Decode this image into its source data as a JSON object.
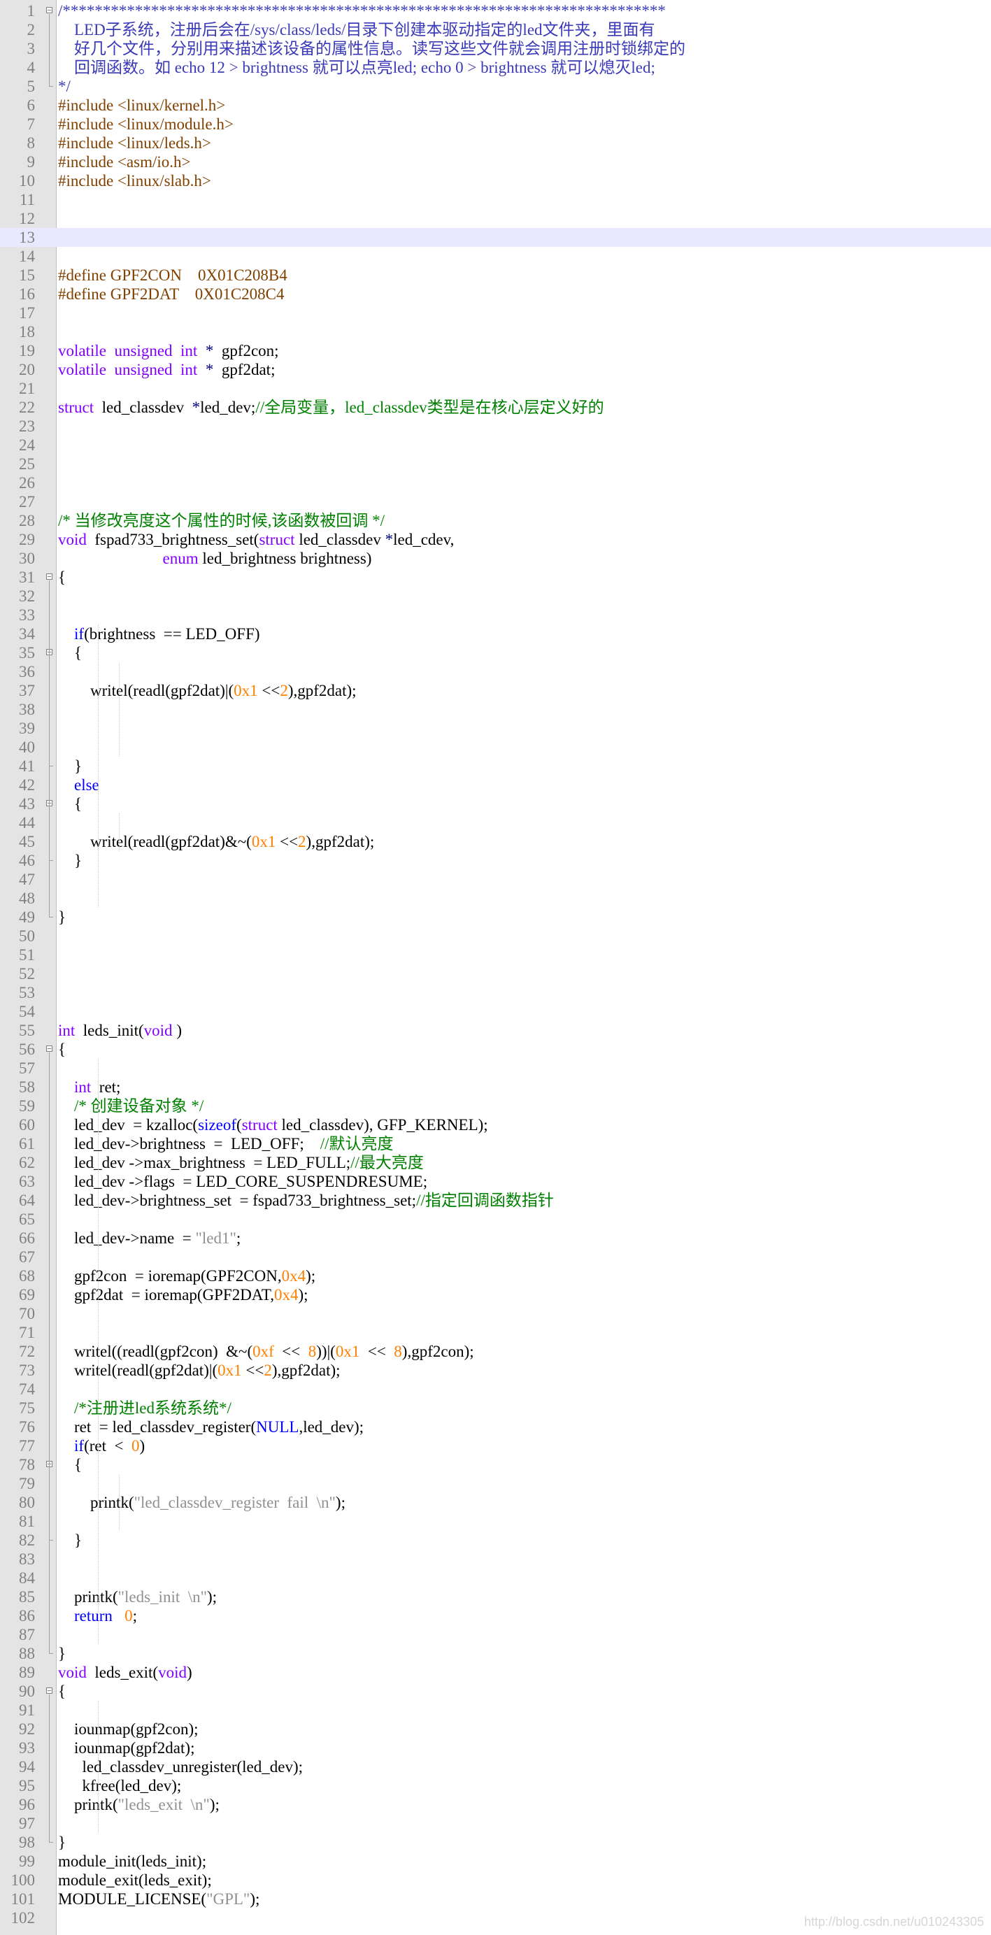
{
  "colors": {
    "comment": "#008000",
    "block_comment": "#3a3ab8",
    "preprocessor": "#804000",
    "type_keyword": "#8000ff",
    "keyword": "#0000ff",
    "number": "#ff8000",
    "string": "#909090",
    "operator": "#000080",
    "gutter_bg": "#e4e4e4",
    "active_line": "#e8e8ff"
  },
  "editor": {
    "active_line": 13,
    "fold_markers": [
      1,
      31,
      35,
      43,
      56,
      78,
      90
    ],
    "lines": [
      [
        [
          "/***************************************************************************",
          "c-blue"
        ]
      ],
      [
        [
          "    LED子系统，注册后会在/sys/class/leds/目录下创建本驱动指定的led文件夹，里面有",
          "c-blue"
        ]
      ],
      [
        [
          "    好几个文件，分别用来描述该设备的属性信息。读写这些文件就会调用注册时锁绑定的",
          "c-blue"
        ]
      ],
      [
        [
          "    回调函数。如 echo 12 > brightness 就可以点亮led; echo 0 > brightness 就可以熄灭led;",
          "c-blue"
        ]
      ],
      [
        [
          "*/",
          "c-blue"
        ]
      ],
      [
        [
          "#include <linux/kernel.h>",
          "c-pre"
        ]
      ],
      [
        [
          "#include <linux/module.h>",
          "c-pre"
        ]
      ],
      [
        [
          "#include <linux/leds.h>",
          "c-pre"
        ]
      ],
      [
        [
          "#include <asm/io.h>",
          "c-pre"
        ]
      ],
      [
        [
          "#include <linux/slab.h>",
          "c-pre"
        ]
      ],
      [],
      [],
      [],
      [],
      [
        [
          "#define GPF2CON    0X01C208B4",
          "c-pre"
        ]
      ],
      [
        [
          "#define GPF2DAT    0X01C208C4",
          "c-pre"
        ]
      ],
      [],
      [],
      [
        [
          "volatile  unsigned  int",
          "c-kw"
        ],
        [
          "  ",
          ""
        ],
        [
          "*",
          "c-op"
        ],
        [
          "  gpf2con;",
          ""
        ]
      ],
      [
        [
          "volatile  unsigned  int",
          "c-kw"
        ],
        [
          "  ",
          ""
        ],
        [
          "*",
          "c-op"
        ],
        [
          "  gpf2dat;",
          ""
        ]
      ],
      [],
      [
        [
          "struct",
          "c-kw"
        ],
        [
          "  led_classdev  ",
          ""
        ],
        [
          "*",
          "c-op"
        ],
        [
          "led_dev;",
          ""
        ],
        [
          "//全局变量，led_classdev类型是在核心层定义好的",
          "c-com"
        ]
      ],
      [],
      [],
      [],
      [],
      [],
      [
        [
          "/* 当修改亮度这个属性的时候,该函数被回调 */",
          "c-com"
        ]
      ],
      [
        [
          "void",
          "c-kw"
        ],
        [
          "  fspad733_brightness_set(",
          ""
        ],
        [
          "struct",
          "c-kw"
        ],
        [
          " led_classdev ",
          ""
        ],
        [
          "*",
          "c-op"
        ],
        [
          "led_cdev,",
          ""
        ]
      ],
      [
        [
          "                          ",
          ""
        ],
        [
          "enum",
          "c-kw"
        ],
        [
          " led_brightness brightness)",
          ""
        ]
      ],
      [
        [
          "{",
          ""
        ]
      ],
      [],
      [],
      [
        [
          "    ",
          ""
        ],
        [
          "if",
          "c-kb"
        ],
        [
          "(brightness  == LED_OFF)",
          ""
        ]
      ],
      [
        [
          "    {",
          ""
        ]
      ],
      [],
      [
        [
          "        writel(readl(gpf2dat)|(",
          ""
        ],
        [
          "0x1",
          "c-num"
        ],
        [
          " <<",
          ""
        ],
        [
          "2",
          "c-num"
        ],
        [
          "),gpf2dat);",
          ""
        ]
      ],
      [],
      [],
      [],
      [
        [
          "    }",
          ""
        ]
      ],
      [
        [
          "    ",
          ""
        ],
        [
          "else",
          "c-kb"
        ]
      ],
      [
        [
          "    {",
          ""
        ]
      ],
      [],
      [
        [
          "        writel(readl(gpf2dat)&~(",
          ""
        ],
        [
          "0x1",
          "c-num"
        ],
        [
          " <<",
          ""
        ],
        [
          "2",
          "c-num"
        ],
        [
          "),gpf2dat);",
          ""
        ]
      ],
      [
        [
          "    }",
          ""
        ]
      ],
      [],
      [],
      [
        [
          "}",
          ""
        ]
      ],
      [],
      [],
      [],
      [],
      [],
      [
        [
          "int",
          "c-kw"
        ],
        [
          "  leds_init(",
          ""
        ],
        [
          "void",
          "c-kw"
        ],
        [
          " )",
          ""
        ]
      ],
      [
        [
          "{",
          ""
        ]
      ],
      [],
      [
        [
          "    ",
          ""
        ],
        [
          "int",
          "c-kw"
        ],
        [
          "  ret;",
          ""
        ]
      ],
      [
        [
          "    ",
          ""
        ],
        [
          "/* 创建设备对象 */",
          "c-com"
        ]
      ],
      [
        [
          "    led_dev  = kzalloc(",
          ""
        ],
        [
          "sizeof",
          "c-kb"
        ],
        [
          "(",
          ""
        ],
        [
          "struct",
          "c-kw"
        ],
        [
          " led_classdev), GFP_KERNEL);",
          ""
        ]
      ],
      [
        [
          "    led_dev->brightness  =  LED_OFF;    ",
          ""
        ],
        [
          "//默认亮度",
          "c-com"
        ]
      ],
      [
        [
          "    led_dev ->max_brightness  = LED_FULL;",
          ""
        ],
        [
          "//最大亮度",
          "c-com"
        ]
      ],
      [
        [
          "    led_dev ->flags  = LED_CORE_SUSPENDRESUME;",
          ""
        ]
      ],
      [
        [
          "    led_dev->brightness_set  = fspad733_brightness_set;",
          ""
        ],
        [
          "//指定回调函数指针",
          "c-com"
        ]
      ],
      [],
      [
        [
          "    led_dev->name  = ",
          ""
        ],
        [
          "\"led1\"",
          "c-str"
        ],
        [
          ";",
          ""
        ]
      ],
      [],
      [
        [
          "    gpf2con  = ioremap(GPF2CON,",
          ""
        ],
        [
          "0x4",
          "c-num"
        ],
        [
          ");",
          ""
        ]
      ],
      [
        [
          "    gpf2dat  = ioremap(GPF2DAT,",
          ""
        ],
        [
          "0x4",
          "c-num"
        ],
        [
          ");",
          ""
        ]
      ],
      [],
      [],
      [
        [
          "    writel((readl(gpf2con)  &~(",
          ""
        ],
        [
          "0xf",
          "c-num"
        ],
        [
          "  <<  ",
          ""
        ],
        [
          "8",
          "c-num"
        ],
        [
          "))|(",
          ""
        ],
        [
          "0x1",
          "c-num"
        ],
        [
          "  <<  ",
          ""
        ],
        [
          "8",
          "c-num"
        ],
        [
          "),gpf2con);",
          ""
        ]
      ],
      [
        [
          "    writel(readl(gpf2dat)|(",
          ""
        ],
        [
          "0x1",
          "c-num"
        ],
        [
          " <<",
          ""
        ],
        [
          "2",
          "c-num"
        ],
        [
          "),gpf2dat);",
          ""
        ]
      ],
      [],
      [
        [
          "    ",
          ""
        ],
        [
          "/*注册进led系统系统*/",
          "c-com"
        ]
      ],
      [
        [
          "    ret  = led_classdev_register(",
          ""
        ],
        [
          "NULL",
          "c-kb"
        ],
        [
          ",led_dev);",
          ""
        ]
      ],
      [
        [
          "    ",
          ""
        ],
        [
          "if",
          "c-kb"
        ],
        [
          "(ret  <  ",
          ""
        ],
        [
          "0",
          "c-num"
        ],
        [
          ")",
          ""
        ]
      ],
      [
        [
          "    {",
          ""
        ]
      ],
      [],
      [
        [
          "        printk(",
          ""
        ],
        [
          "\"led_classdev_register  fail  \\n\"",
          "c-str"
        ],
        [
          ");",
          ""
        ]
      ],
      [],
      [
        [
          "    }",
          ""
        ]
      ],
      [],
      [],
      [
        [
          "    printk(",
          ""
        ],
        [
          "\"leds_init  \\n\"",
          "c-str"
        ],
        [
          ");",
          ""
        ]
      ],
      [
        [
          "    ",
          ""
        ],
        [
          "return",
          "c-kb"
        ],
        [
          "   ",
          ""
        ],
        [
          "0",
          "c-num"
        ],
        [
          ";",
          ""
        ]
      ],
      [],
      [
        [
          "}",
          ""
        ]
      ],
      [
        [
          "void",
          "c-kw"
        ],
        [
          "  leds_exit(",
          ""
        ],
        [
          "void",
          "c-kw"
        ],
        [
          ")",
          ""
        ]
      ],
      [
        [
          "{",
          ""
        ]
      ],
      [],
      [
        [
          "    iounmap(gpf2con);",
          ""
        ]
      ],
      [
        [
          "    iounmap(gpf2dat);",
          ""
        ]
      ],
      [
        [
          "      led_classdev_unregister(led_dev);",
          ""
        ]
      ],
      [
        [
          "      kfree(led_dev);",
          ""
        ]
      ],
      [
        [
          "    printk(",
          ""
        ],
        [
          "\"leds_exit  \\n\"",
          "c-str"
        ],
        [
          ");",
          ""
        ]
      ],
      [],
      [
        [
          "}",
          ""
        ]
      ],
      [
        [
          "module_init(leds_init);",
          ""
        ]
      ],
      [
        [
          "module_exit(leds_exit);",
          ""
        ]
      ],
      [
        [
          "MODULE_LICENSE(",
          ""
        ],
        [
          "\"GPL\"",
          "c-str"
        ],
        [
          ");",
          ""
        ]
      ],
      []
    ]
  },
  "watermark": "http://blog.csdn.net/u010243305"
}
